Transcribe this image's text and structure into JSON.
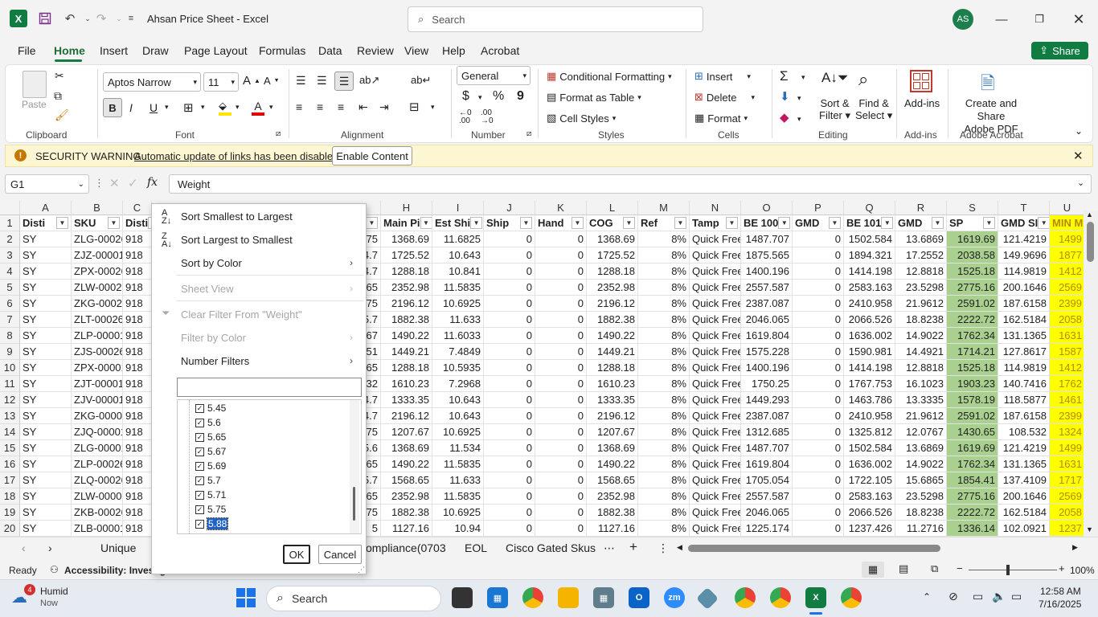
{
  "title_bar": {
    "app_title": "Ahsan Price Sheet  -  Excel",
    "search_placeholder": "Search",
    "avatar": "AS"
  },
  "menu": {
    "items": [
      "File",
      "Home",
      "Insert",
      "Draw",
      "Page Layout",
      "Formulas",
      "Data",
      "Review",
      "View",
      "Help",
      "Acrobat"
    ],
    "active": "Home",
    "share": "Share"
  },
  "ribbon": {
    "clipboard": {
      "paste": "Paste",
      "group": "Clipboard"
    },
    "font": {
      "name": "Aptos Narrow",
      "size": "11",
      "bold": "B",
      "italic": "I",
      "underline": "U",
      "group": "Font"
    },
    "alignment": {
      "group": "Alignment"
    },
    "number": {
      "format": "General",
      "currency": "$",
      "percent": "%",
      "comma": "9",
      "group": "Number"
    },
    "styles": {
      "conditional": "Conditional Formatting",
      "table": "Format as Table",
      "cell": "Cell Styles",
      "group": "Styles"
    },
    "cells": {
      "insert": "Insert",
      "delete": "Delete",
      "format": "Format",
      "group": "Cells"
    },
    "editing": {
      "sort1": "Sort &",
      "sort2": "Filter",
      "find1": "Find &",
      "find2": "Select",
      "group": "Editing"
    },
    "addins": {
      "label": "Add-ins",
      "group": "Add-ins"
    },
    "acrobat": {
      "label1": "Create and Share",
      "label2": "Adobe PDF",
      "group": "Adobe Acrobat"
    }
  },
  "security": {
    "title": "SECURITY WARNING",
    "message": "Automatic update of links has been disabled",
    "button": "Enable Content"
  },
  "formula": {
    "namebox": "G1",
    "fx": "fx",
    "value": "Weight"
  },
  "columns": [
    "A",
    "B",
    "C",
    "",
    "H",
    "I",
    "J",
    "K",
    "L",
    "M",
    "N",
    "O",
    "P",
    "Q",
    "R",
    "S",
    "T",
    "U"
  ],
  "headers": [
    "Disti",
    "SKU",
    "Disti",
    "",
    "Main Pi",
    "Est Shi",
    "Ship",
    "Hand",
    "COG",
    "Ref",
    "Tamp",
    "BE 100",
    "GMD",
    "BE 101",
    "GMD",
    "SP",
    "GMD SI",
    "MIN M"
  ],
  "rows": [
    [
      "SY",
      "ZLG-00026",
      "918",
      "75",
      "1368.69",
      "11.6825",
      "0",
      "0",
      "1368.69",
      "8%",
      "Quick Free",
      "1487.707",
      "0",
      "1502.584",
      "13.6869",
      "1619.69",
      "121.4219",
      "1499"
    ],
    [
      "SY",
      "ZJZ-00001",
      "918",
      "4.7",
      "1725.52",
      "10.643",
      "0",
      "0",
      "1725.52",
      "8%",
      "Quick Free",
      "1875.565",
      "0",
      "1894.321",
      "17.2552",
      "2038.58",
      "149.9696",
      "1877"
    ],
    [
      "SY",
      "ZPX-00026",
      "918",
      "4.7",
      "1288.18",
      "10.841",
      "0",
      "0",
      "1288.18",
      "8%",
      "Quick Free",
      "1400.196",
      "0",
      "1414.198",
      "12.8818",
      "1525.18",
      "114.9819",
      "1412"
    ],
    [
      "SY",
      "ZLW-00026",
      "918",
      "65",
      "2352.98",
      "11.5835",
      "0",
      "0",
      "2352.98",
      "8%",
      "Quick Free",
      "2557.587",
      "0",
      "2583.163",
      "23.5298",
      "2775.16",
      "200.1646",
      "2569"
    ],
    [
      "SY",
      "ZKG-00026",
      "918",
      "75",
      "2196.12",
      "10.6925",
      "0",
      "0",
      "2196.12",
      "8%",
      "Quick Free",
      "2387.087",
      "0",
      "2410.958",
      "21.9612",
      "2591.02",
      "187.6158",
      "2399"
    ],
    [
      "SY",
      "ZLT-00026",
      "918",
      "5.7",
      "1882.38",
      "11.633",
      "0",
      "0",
      "1882.38",
      "8%",
      "Quick Free",
      "2046.065",
      "0",
      "2066.526",
      "18.8238",
      "2222.72",
      "162.5184",
      "2058"
    ],
    [
      "SY",
      "ZLP-00001",
      "918",
      "67",
      "1490.22",
      "11.6033",
      "0",
      "0",
      "1490.22",
      "8%",
      "Quick Free",
      "1619.804",
      "0",
      "1636.002",
      "14.9022",
      "1762.34",
      "131.1365",
      "1631"
    ],
    [
      "SY",
      "ZJS-00026",
      "918",
      "51",
      "1449.21",
      "7.4849",
      "0",
      "0",
      "1449.21",
      "8%",
      "Quick Free",
      "1575.228",
      "0",
      "1590.981",
      "14.4921",
      "1714.21",
      "127.8617",
      "1587"
    ],
    [
      "SY",
      "ZPX-00001",
      "918",
      "65",
      "1288.18",
      "10.5935",
      "0",
      "0",
      "1288.18",
      "8%",
      "Quick Free",
      "1400.196",
      "0",
      "1414.198",
      "12.8818",
      "1525.18",
      "114.9819",
      "1412"
    ],
    [
      "SY",
      "ZJT-00001",
      "918",
      "32",
      "1610.23",
      "7.2968",
      "0",
      "0",
      "1610.23",
      "8%",
      "Quick Free",
      "1750.25",
      "0",
      "1767.753",
      "16.1023",
      "1903.23",
      "140.7416",
      "1762"
    ],
    [
      "SY",
      "ZJV-00001",
      "918",
      "4.7",
      "1333.35",
      "10.643",
      "0",
      "0",
      "1333.35",
      "8%",
      "Quick Free",
      "1449.293",
      "0",
      "1463.786",
      "13.3335",
      "1578.19",
      "118.5877",
      "1461"
    ],
    [
      "SY",
      "ZKG-00001",
      "918",
      "4.7",
      "2196.12",
      "10.643",
      "0",
      "0",
      "2196.12",
      "8%",
      "Quick Free",
      "2387.087",
      "0",
      "2410.958",
      "21.9612",
      "2591.02",
      "187.6158",
      "2399"
    ],
    [
      "SY",
      "ZJQ-00001",
      "918",
      "75",
      "1207.67",
      "10.6925",
      "0",
      "0",
      "1207.67",
      "8%",
      "Quick Free",
      "1312.685",
      "0",
      "1325.812",
      "12.0767",
      "1430.65",
      "108.532",
      "1324"
    ],
    [
      "SY",
      "ZLG-00001",
      "918",
      "5.6",
      "1368.69",
      "11.534",
      "0",
      "0",
      "1368.69",
      "8%",
      "Quick Free",
      "1487.707",
      "0",
      "1502.584",
      "13.6869",
      "1619.69",
      "121.4219",
      "1499"
    ],
    [
      "SY",
      "ZLP-00026",
      "918",
      "65",
      "1490.22",
      "11.5835",
      "0",
      "0",
      "1490.22",
      "8%",
      "Quick Free",
      "1619.804",
      "0",
      "1636.002",
      "14.9022",
      "1762.34",
      "131.1365",
      "1631"
    ],
    [
      "SY",
      "ZLQ-00026",
      "918",
      "5.7",
      "1568.65",
      "11.633",
      "0",
      "0",
      "1568.65",
      "8%",
      "Quick Free",
      "1705.054",
      "0",
      "1722.105",
      "15.6865",
      "1854.41",
      "137.4109",
      "1717"
    ],
    [
      "SY",
      "ZLW-00001",
      "918",
      "65",
      "2352.98",
      "11.5835",
      "0",
      "0",
      "2352.98",
      "8%",
      "Quick Free",
      "2557.587",
      "0",
      "2583.163",
      "23.5298",
      "2775.16",
      "200.1646",
      "2569"
    ],
    [
      "SY",
      "ZKB-00026",
      "918",
      "75",
      "1882.38",
      "10.6925",
      "0",
      "0",
      "1882.38",
      "8%",
      "Quick Free",
      "2046.065",
      "0",
      "2066.526",
      "18.8238",
      "2222.72",
      "162.5184",
      "2058"
    ],
    [
      "SY",
      "ZLB-00001",
      "918",
      "5",
      "1127.16",
      "10.94",
      "0",
      "0",
      "1127.16",
      "8%",
      "Quick Free",
      "1225.174",
      "0",
      "1237.426",
      "11.2716",
      "1336.14",
      "102.0921",
      "1237"
    ]
  ],
  "row_numbers": [
    "1",
    "2",
    "3",
    "4",
    "5",
    "6",
    "7",
    "8",
    "9",
    "10",
    "11",
    "12",
    "13",
    "14",
    "15",
    "16",
    "17",
    "18",
    "19",
    "20"
  ],
  "filter_menu": {
    "sort_asc": "Sort Smallest to Largest",
    "sort_desc": "Sort Largest to Smallest",
    "sort_color": "Sort by Color",
    "sheet_view": "Sheet View",
    "clear": "Clear Filter From \"Weight\"",
    "filter_color": "Filter by Color",
    "number_filters": "Number Filters",
    "search_value": "",
    "values": [
      "5.45",
      "5.6",
      "5.65",
      "5.67",
      "5.69",
      "5.7",
      "5.71",
      "5.75",
      "5.88"
    ],
    "ok": "OK",
    "cancel": "Cancel"
  },
  "sheets": {
    "tabs": [
      "Unique",
      "ompliance(0703",
      "EOL",
      "Cisco Gated Skus"
    ]
  },
  "status": {
    "ready": "Ready",
    "accessibility": "Accessibility: Investig",
    "zoom": "100%"
  },
  "taskbar": {
    "weather_temp": "4",
    "weather_label": "Humid",
    "weather_sub": "Now",
    "search": "Search",
    "time": "12:58 AM",
    "date": "7/16/2025"
  }
}
